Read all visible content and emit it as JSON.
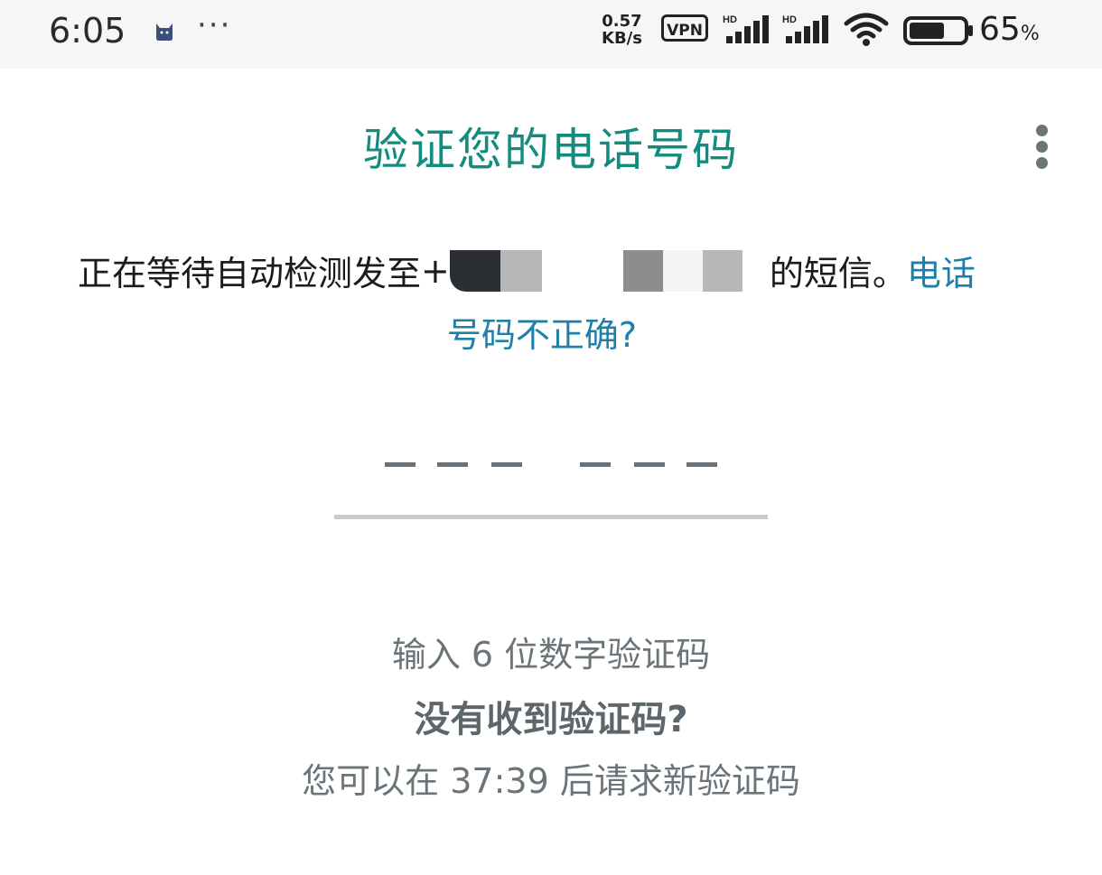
{
  "status_bar": {
    "time": "6:05",
    "more": "···",
    "speed_value": "0.57",
    "speed_unit": "KB/s",
    "vpn": "VPN",
    "signal_label": "HD",
    "battery_level": 0.65,
    "battery_percent": "65",
    "percent_sign": "%"
  },
  "header": {
    "title": "验证您的电话号码",
    "menu_icon": "more-vert-icon"
  },
  "description": {
    "prefix": "正在等待自动检测发至",
    "phone_visible": "+",
    "suffix": "的短信。",
    "link_part1": "电话",
    "link_part2": "号码不正确?"
  },
  "code_input": {
    "digits": 6,
    "placeholder_dash": "—"
  },
  "hint": "输入 6 位数字验证码",
  "no_code": "没有收到验证码?",
  "resend": "您可以在 37:39 后请求新验证码",
  "colors": {
    "title": "#128c7e",
    "link": "#1e7fa8",
    "muted": "#6b7478"
  }
}
